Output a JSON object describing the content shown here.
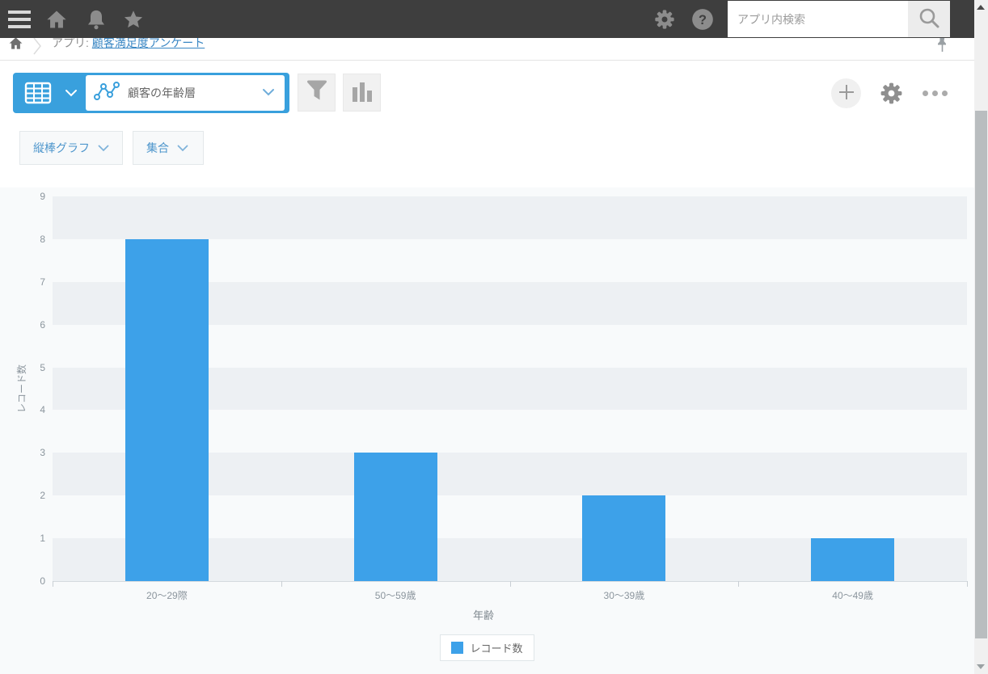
{
  "topbar": {
    "search_placeholder": "アプリ内検索"
  },
  "breadcrumb": {
    "prefix": "アプリ:",
    "app_name": "顧客満足度アンケート"
  },
  "view_selector": {
    "label": "顧客の年齢層"
  },
  "controls": {
    "chart_type_label": "縦棒グラフ",
    "aggregation_label": "集合"
  },
  "chart_data": {
    "type": "bar",
    "categories": [
      "20〜29際",
      "50〜59歳",
      "30〜39歳",
      "40〜49歳"
    ],
    "values": [
      8,
      3,
      2,
      1
    ],
    "title": "",
    "xlabel": "年齢",
    "ylabel": "レコード数",
    "ylim": [
      0,
      9
    ],
    "ytick_step": 1,
    "legend": [
      "レコード数"
    ],
    "legend_position": "bottom",
    "grid": "alternating-horizontal-bands",
    "bar_color": "#3da1e9",
    "band_color": "#edf0f3"
  },
  "icons": {
    "hamburger-icon": "three horizontal bars",
    "home-icon": "house",
    "bell-icon": "notification bell",
    "star-icon": "favorite star",
    "gear-icon": "settings gear",
    "help-icon": "question mark circle",
    "search-icon": "magnifier",
    "pin-icon": "push pin",
    "table-icon": "data table grid",
    "line-chart-icon": "connected data points",
    "filter-icon": "funnel",
    "bar-chart-icon": "three vertical bars",
    "plus-icon": "plus in circle",
    "ellipsis-icon": "three dots",
    "chevron-down-icon": "v arrow"
  },
  "colors": {
    "topbar_bg": "#3e3e3e",
    "accent_blue": "#39a0dd",
    "bar_blue": "#3da1e9",
    "chart_bg": "#f8fafb",
    "band_gray": "#edf0f3",
    "link_blue": "#3a87c4"
  }
}
